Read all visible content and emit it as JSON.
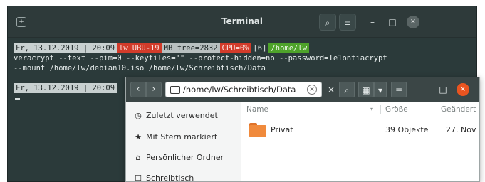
{
  "terminal": {
    "title": "Terminal",
    "new_tab_icon": "+",
    "search_icon": "⌕",
    "menu_icon": "≡",
    "minimize_icon": "–",
    "maximize_icon": "□",
    "close_icon": "×",
    "prompt1": {
      "date": "Fr, 13.12.2019 | 20:09",
      "user": "lw",
      "host": "UBU-19",
      "mem": "MB free=2832",
      "cpu": "CPU=0%",
      "jobs": "[6]",
      "path": "/home/lw"
    },
    "command_line1": "veracrypt --text --pim=0 --keyfiles=\"\" --protect-hidden=no --password=Te1ontiacrypt",
    "command_line2": "--mount /home/lw/debian10.iso /home/lw/Schreibtisch/Data",
    "prompt2": {
      "date": "Fr, 13.12.2019 | 20:09"
    }
  },
  "files": {
    "back_icon": "‹",
    "forward_icon": "›",
    "path": "/home/lw/Schreibtisch/Data",
    "clear_icon": "×",
    "close_search_icon": "×",
    "search_icon": "⌕",
    "view_icon": "▦",
    "view_dropdown_icon": "▾",
    "menu_icon": "≡",
    "minimize_icon": "–",
    "maximize_icon": "□",
    "close_icon": "×",
    "sidebar": [
      {
        "icon": "◷",
        "label": "Zuletzt verwendet"
      },
      {
        "icon": "★",
        "label": "Mit Stern markiert"
      },
      {
        "icon": "⌂",
        "label": "Persönlicher Ordner"
      },
      {
        "icon": "☐",
        "label": "Schreibtisch"
      }
    ],
    "columns": {
      "name": "Name",
      "sort_arrow": "▾",
      "size": "Größe",
      "modified": "Geändert"
    },
    "rows": [
      {
        "name": "Privat",
        "size": "39 Objekte",
        "modified": "27. Nov"
      }
    ]
  }
}
